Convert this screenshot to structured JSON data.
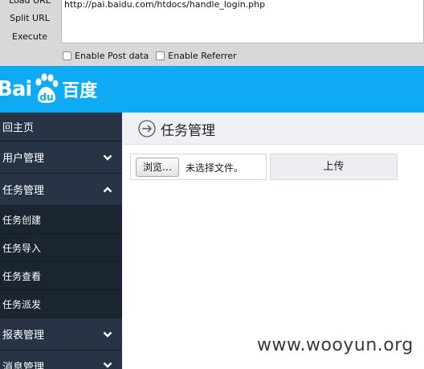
{
  "hackbar": {
    "buttons": {
      "load_url": "Load URL",
      "split_url": "Split URL",
      "execute": "Execute"
    },
    "url": "http://pai.baidu.com/htdocs/handle_login.php",
    "options": {
      "post_data": "Enable Post data",
      "referrer": "Enable Referrer"
    }
  },
  "header": {
    "logo_left": "Bai",
    "logo_right": "du",
    "logo_cn": "百度",
    "color": "#0eaaf3"
  },
  "sidebar": {
    "items": [
      {
        "label": "回主页",
        "type": "top"
      },
      {
        "label": "用户管理",
        "type": "top",
        "icon": "chevron-down-icon"
      },
      {
        "label": "任务管理",
        "type": "top",
        "icon": "chevron-up-icon"
      },
      {
        "label": "任务创建",
        "type": "sub"
      },
      {
        "label": "任务导入",
        "type": "sub"
      },
      {
        "label": "任务查看",
        "type": "sub"
      },
      {
        "label": "任务派发",
        "type": "sub"
      },
      {
        "label": "报表管理",
        "type": "top",
        "icon": "chevron-down-icon"
      },
      {
        "label": "消息管理",
        "type": "top",
        "icon": "chevron-down-icon"
      }
    ]
  },
  "main": {
    "title": "任务管理",
    "title_icon": "circle-arrow-right-icon",
    "browse_label": "浏览…",
    "file_status": "未选择文件。",
    "upload_label": "上传"
  },
  "watermark": "www.wooyun.org"
}
